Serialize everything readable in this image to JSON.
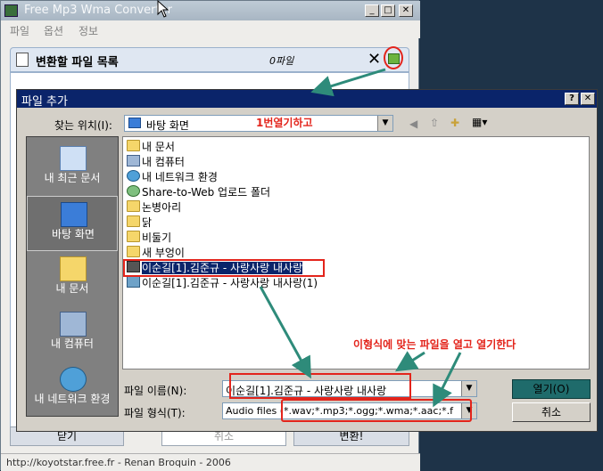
{
  "app": {
    "title": "Free Mp3 Wma Converter",
    "menu": [
      "파일",
      "옵션",
      "정보"
    ],
    "list_title": "변환할 파일 목록",
    "file_count": "0파일",
    "buttons": {
      "close": "닫기",
      "cancel": "취소",
      "convert": "변환!"
    },
    "status": "http://koyotstar.free.fr - Renan Broquin - 2006"
  },
  "dialog": {
    "title": "파일 추가",
    "lookin_label": "찾는 위치(I):",
    "lookin_value": "바탕 화면",
    "places": [
      "내 최근 문서",
      "바탕 화면",
      "내 문서",
      "내 컴퓨터",
      "내 네트워크 환경"
    ],
    "files": [
      "내 문서",
      "내 컴퓨터",
      "내 네트워크 환경",
      "Share-to-Web 업로드 폴더",
      "논병아리",
      "닭",
      "비둘기",
      "새 부엉이",
      "이순길[1].김준규 - 사랑사랑 내사랑",
      "이순길[1].김준규 - 사랑사랑 내사랑(1)"
    ],
    "filename_label": "파일 이름(N):",
    "filename_value": "이순길[1].김준규 - 사랑사랑 내사랑",
    "filetype_label": "파일 형식(T):",
    "filetype_value": "Audio files (*.wav;*.mp3;*.ogg;*.wma;*.aac;*.f",
    "open_button": "열기(O)",
    "cancel_button": "취소"
  },
  "annotations": {
    "open_once": "1번열기하고",
    "instruction": "이형식에 맞는 파일을 열고 열기한다"
  },
  "colors": {
    "accent": "#e3241b",
    "selection": "#0a246a",
    "open_button": "#1f6b6b",
    "arrow": "#2e8b7a"
  }
}
